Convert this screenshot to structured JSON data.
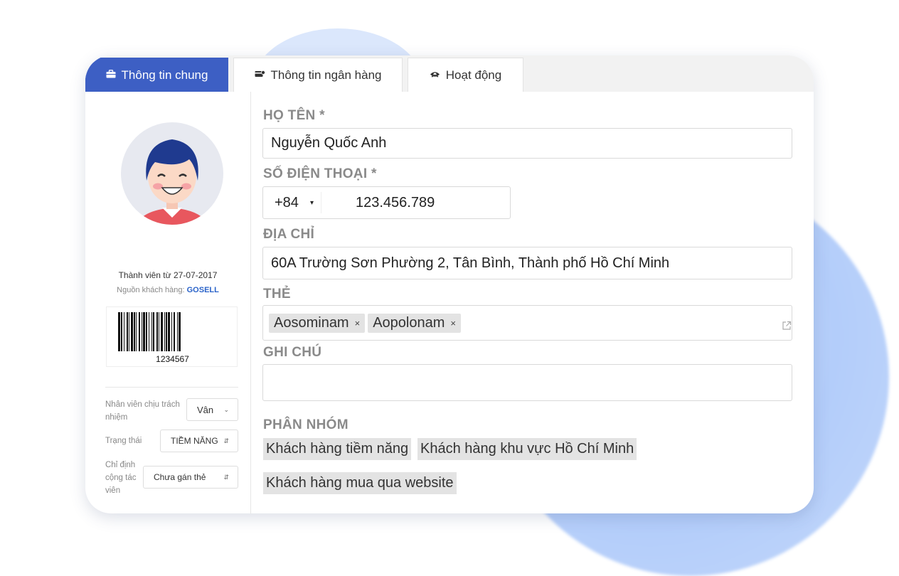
{
  "tabs": [
    {
      "label": "Thông tin chung",
      "icon": "briefcase-icon",
      "active": true
    },
    {
      "label": "Thông tin ngân hàng",
      "icon": "bank-card-icon",
      "active": false
    },
    {
      "label": "Hoạt động",
      "icon": "activity-icon",
      "active": false
    }
  ],
  "profile": {
    "member_since": "Thành viên từ 27-07-2017",
    "source_label": "Nguồn khách hàng:",
    "source_value": "GOSELL",
    "barcode": "1234567"
  },
  "sidebar": {
    "staff_label": "Nhân viên chịu trách nhiệm",
    "staff_value": "Vân",
    "status_label": "Trạng thái",
    "status_value": "TIỀM NĂNG",
    "affiliate_label": "Chỉ định cộng tác viên",
    "affiliate_value": "Chưa gán thẻ"
  },
  "form": {
    "name_label": "HỌ TÊN *",
    "name_value": "Nguyễn Quốc Anh",
    "phone_label": "SỐ ĐIỆN THOẠI *",
    "phone_code": "+84",
    "phone_value": "123.456.789",
    "address_label": "ĐỊA CHỈ",
    "address_value": "60A Trường Sơn Phường 2, Tân Bình, Thành phố Hồ Chí Minh",
    "tags_label": "THẺ",
    "tags": [
      "Aosominam",
      "Aopolonam"
    ],
    "note_label": "GHI CHÚ",
    "note_value": "",
    "groups_label": "PHÂN NHÓM",
    "groups": [
      "Khách hàng tiềm năng",
      "Khách hàng khu vực Hồ Chí Minh",
      "Khách hàng mua qua website"
    ]
  },
  "colors": {
    "accent": "#3d5fc4",
    "source_link": "#2a63c9",
    "label_gray": "#8a8a8a",
    "background_blob": "#b3cdfa"
  }
}
